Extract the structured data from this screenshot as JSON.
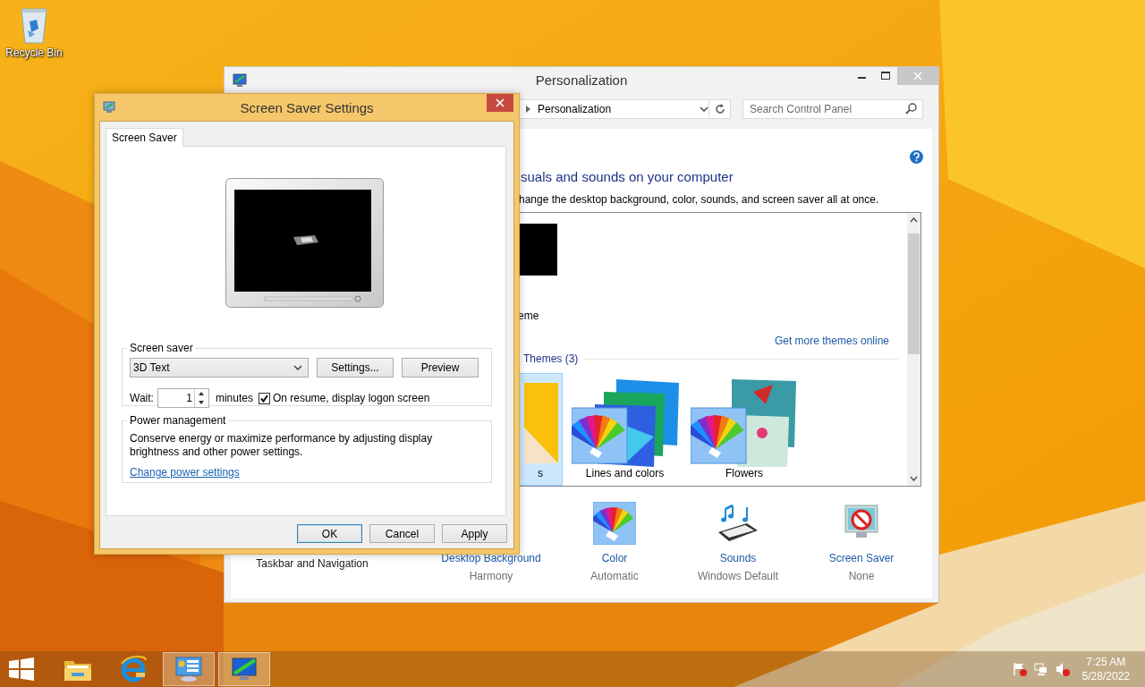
{
  "desktop": {
    "icons": [
      {
        "label": "Recycle Bin"
      }
    ]
  },
  "personalization_window": {
    "title": "Personalization",
    "address": "Personalization",
    "search": {
      "placeholder": "Search Control Panel"
    },
    "heading": "suals and sounds on your computer",
    "subtitle": "hange the desktop background, color, sounds, and screen saver all at once.",
    "themes": {
      "current_label": "eme",
      "get_more_link": "Get more themes online",
      "group_label": "Themes (3)",
      "items": [
        {
          "label": "s",
          "selected": true
        },
        {
          "label": "Lines and colors",
          "selected": false
        },
        {
          "label": "Flowers",
          "selected": false
        }
      ]
    },
    "settings": [
      {
        "kind": "navigation",
        "label": "Taskbar and Navigation"
      },
      {
        "kind": "background",
        "label": "Desktop Background",
        "value": "Harmony"
      },
      {
        "kind": "color",
        "label": "Color",
        "value": "Automatic"
      },
      {
        "kind": "sounds",
        "label": "Sounds",
        "value": "Windows Default"
      },
      {
        "kind": "screensaver",
        "label": "Screen Saver",
        "value": "None"
      }
    ]
  },
  "dialog": {
    "title": "Screen Saver Settings",
    "tabs": [
      {
        "label": "Screen Saver",
        "selected": true
      }
    ],
    "screen_saver_group": {
      "label": "Screen saver",
      "selected_saver": "3D Text",
      "buttons": [
        "Settings...",
        "Preview"
      ],
      "wait_label": "Wait:",
      "wait_value": "1",
      "minutes_label": "minutes",
      "logon_checkbox": {
        "label": "On resume, display logon screen",
        "checked": true
      }
    },
    "power_group": {
      "label": "Power management",
      "description": "Conserve energy or maximize performance by adjusting display brightness and other power settings.",
      "link": "Change power settings"
    },
    "buttons": [
      {
        "label": "OK",
        "default": true
      },
      {
        "label": "Cancel",
        "default": false
      },
      {
        "label": "Apply",
        "default": false
      }
    ]
  },
  "taskbar": {
    "apps": [
      {
        "kind": "explorer",
        "highlighted": false
      },
      {
        "kind": "browser",
        "highlighted": false
      },
      {
        "kind": "control-panel",
        "highlighted": true
      },
      {
        "kind": "personalization",
        "highlighted": true
      }
    ],
    "clock": {
      "time": "7:25 AM",
      "date": "5/28/2022"
    }
  }
}
